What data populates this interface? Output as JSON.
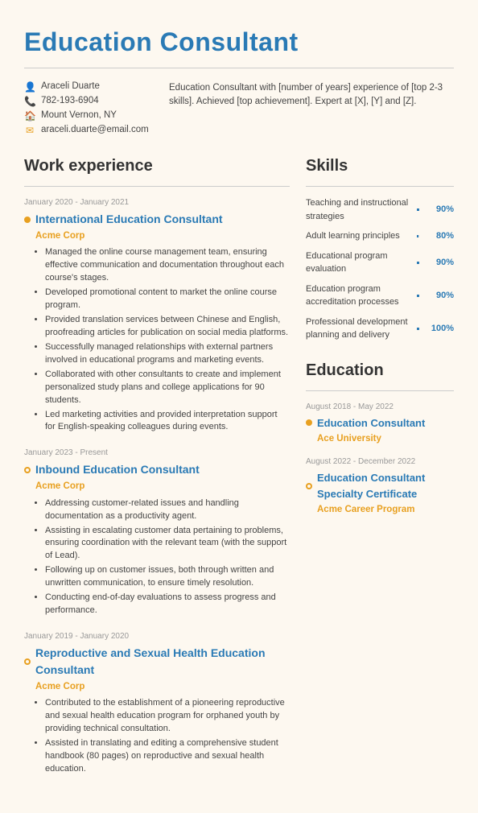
{
  "page": {
    "title": "Education Consultant",
    "divider": true
  },
  "header": {
    "name": "Araceli Duarte",
    "phone": "782-193-6904",
    "location": "Mount Vernon, NY",
    "email": "araceli.duarte@email.com",
    "summary": "Education Consultant with [number of years] experience of [top 2-3 skills]. Achieved [top achievement]. Expert at [X], [Y] and [Z]."
  },
  "work": {
    "section_title": "Work experience",
    "items": [
      {
        "date": "January 2020 - January 2021",
        "title": "International Education Consultant",
        "company": "Acme Corp",
        "dot": "filled",
        "bullets": [
          "Managed the online course management team, ensuring effective communication and documentation throughout each course's stages.",
          "Developed promotional content to market the online course program.",
          "Provided translation services between Chinese and English, proofreading articles for publication on social media platforms.",
          "Successfully managed relationships with external partners involved in educational programs and marketing events.",
          "Collaborated with other consultants to create and implement personalized study plans and college applications for 90 students.",
          "Led marketing activities and provided interpretation support for English-speaking colleagues during events."
        ]
      },
      {
        "date": "January 2023 - Present",
        "title": "Inbound Education Consultant",
        "company": "Acme Corp",
        "dot": "empty",
        "bullets": [
          "Addressing customer-related issues and handling documentation as a productivity agent.",
          "Assisting in escalating customer data pertaining to problems, ensuring coordination with the relevant team (with the support of Lead).",
          "Following up on customer issues, both through written and unwritten communication, to ensure timely resolution.",
          "Conducting end-of-day evaluations to assess progress and performance."
        ]
      },
      {
        "date": "January 2019 - January 2020",
        "title": "Reproductive and Sexual Health Education Consultant",
        "company": "Acme Corp",
        "dot": "empty",
        "bullets": [
          "Contributed to the establishment of a pioneering reproductive and sexual health education program for orphaned youth by providing technical consultation.",
          "Assisted in translating and editing a comprehensive student handbook (80 pages) on reproductive and sexual health education."
        ]
      }
    ]
  },
  "skills": {
    "section_title": "Skills",
    "items": [
      {
        "name": "Teaching and instructional strategies",
        "pct": 90
      },
      {
        "name": "Adult learning principles",
        "pct": 80
      },
      {
        "name": "Educational program evaluation",
        "pct": 90
      },
      {
        "name": "Education program accreditation processes",
        "pct": 90
      },
      {
        "name": "Professional development planning and delivery",
        "pct": 100
      }
    ]
  },
  "education": {
    "section_title": "Education",
    "items": [
      {
        "date": "August 2018 - May 2022",
        "title": "Education Consultant",
        "institution": "Ace University",
        "dot": "filled"
      },
      {
        "date": "August 2022 - December 2022",
        "title": "Education Consultant Specialty Certificate",
        "institution": "Acme Career Program",
        "dot": "empty"
      }
    ]
  }
}
